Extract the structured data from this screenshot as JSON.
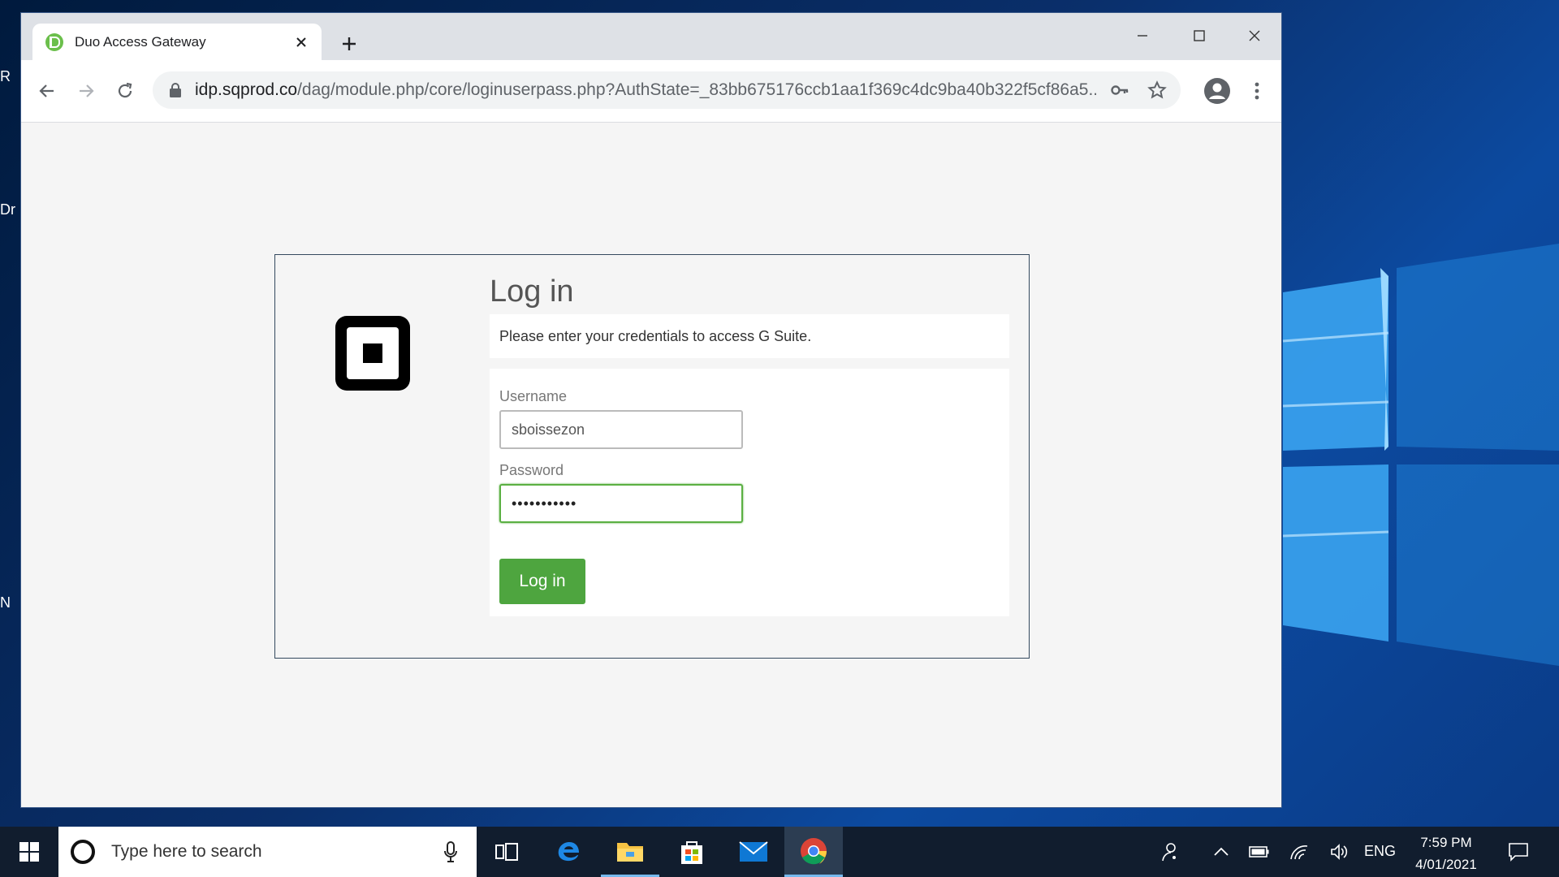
{
  "browser": {
    "tab_title": "Duo Access Gateway",
    "url_host": "idp.sqprod.co",
    "url_path": "/dag/module.php/core/loginuserpass.php?AuthState=_83bb675176ccb1aa1f369c4dc9ba40b322f5cf86a5..."
  },
  "login": {
    "title": "Log in",
    "prompt": "Please enter your credentials to access G Suite.",
    "username_label": "Username",
    "username_value": "sboissezon",
    "password_label": "Password",
    "password_value": "•••••••••••",
    "submit_label": "Log in"
  },
  "taskbar": {
    "search_placeholder": "Type here to search",
    "language": "ENG",
    "time": "7:59 PM",
    "date": "4/01/2021"
  },
  "desktop": {
    "icon_fragments": [
      "R",
      "Dr",
      "N"
    ]
  },
  "colors": {
    "accent_green": "#4ea53f",
    "focus_green": "#5bb043",
    "taskbar": "#111d2e"
  }
}
